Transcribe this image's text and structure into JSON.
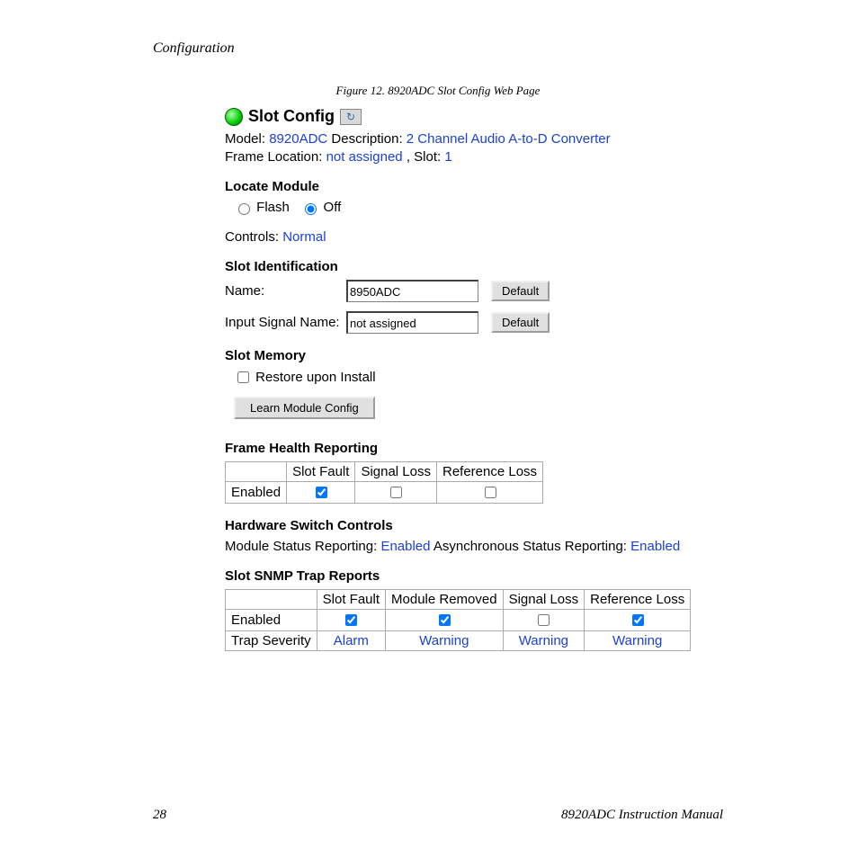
{
  "pageHeader": "Configuration",
  "figureCaption": "Figure 12.  8920ADC Slot Config Web Page",
  "title": "Slot Config",
  "info": {
    "modelLabel": "Model:",
    "modelValue": "8920ADC",
    "descLabel": "Description:",
    "descValue": "2 Channel Audio A-to-D Converter",
    "frameLocLabel": "Frame Location:",
    "frameLocValue": "not assigned",
    "slotLabel": ", Slot:",
    "slotValue": "1"
  },
  "locateModule": {
    "heading": "Locate Module",
    "option1": "Flash",
    "option2": "Off"
  },
  "controls": {
    "label": "Controls:",
    "value": "Normal"
  },
  "slotId": {
    "heading": "Slot Identification",
    "nameLabel": "Name:",
    "nameValue": "8950ADC",
    "inputSigLabel": "Input Signal Name:",
    "inputSigValue": "not assigned",
    "defaultBtn": "Default"
  },
  "slotMemory": {
    "heading": "Slot Memory",
    "restoreLabel": "Restore upon Install",
    "learnBtn": "Learn Module Config"
  },
  "frameHealth": {
    "heading": "Frame Health Reporting",
    "cols": [
      "",
      "Slot Fault",
      "Signal Loss",
      "Reference Loss"
    ],
    "rowLabel": "Enabled",
    "checked": [
      true,
      false,
      false
    ]
  },
  "hwSwitch": {
    "heading": "Hardware Switch Controls",
    "modStatusLabel": "Module Status Reporting:",
    "modStatusValue": "Enabled",
    "asyncLabel": "Asynchronous Status Reporting:",
    "asyncValue": "Enabled"
  },
  "snmp": {
    "heading": "Slot SNMP Trap Reports",
    "cols": [
      "",
      "Slot Fault",
      "Module Removed",
      "Signal Loss",
      "Reference Loss"
    ],
    "enabledLabel": "Enabled",
    "enabled": [
      true,
      true,
      false,
      true
    ],
    "sevLabel": "Trap Severity",
    "severity": [
      "Alarm",
      "Warning",
      "Warning",
      "Warning"
    ]
  },
  "footer": {
    "pageNum": "28",
    "manual": "8920ADC Instruction Manual"
  }
}
